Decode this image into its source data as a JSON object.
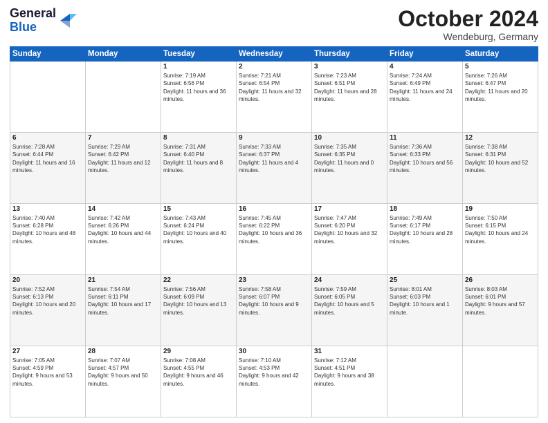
{
  "logo": {
    "line1": "General",
    "line2": "Blue"
  },
  "header": {
    "month": "October 2024",
    "location": "Wendeburg, Germany"
  },
  "weekdays": [
    "Sunday",
    "Monday",
    "Tuesday",
    "Wednesday",
    "Thursday",
    "Friday",
    "Saturday"
  ],
  "weeks": [
    [
      {
        "day": "",
        "sunrise": "",
        "sunset": "",
        "daylight": ""
      },
      {
        "day": "",
        "sunrise": "",
        "sunset": "",
        "daylight": ""
      },
      {
        "day": "1",
        "sunrise": "Sunrise: 7:19 AM",
        "sunset": "Sunset: 6:56 PM",
        "daylight": "Daylight: 11 hours and 36 minutes."
      },
      {
        "day": "2",
        "sunrise": "Sunrise: 7:21 AM",
        "sunset": "Sunset: 6:54 PM",
        "daylight": "Daylight: 11 hours and 32 minutes."
      },
      {
        "day": "3",
        "sunrise": "Sunrise: 7:23 AM",
        "sunset": "Sunset: 6:51 PM",
        "daylight": "Daylight: 11 hours and 28 minutes."
      },
      {
        "day": "4",
        "sunrise": "Sunrise: 7:24 AM",
        "sunset": "Sunset: 6:49 PM",
        "daylight": "Daylight: 11 hours and 24 minutes."
      },
      {
        "day": "5",
        "sunrise": "Sunrise: 7:26 AM",
        "sunset": "Sunset: 6:47 PM",
        "daylight": "Daylight: 11 hours and 20 minutes."
      }
    ],
    [
      {
        "day": "6",
        "sunrise": "Sunrise: 7:28 AM",
        "sunset": "Sunset: 6:44 PM",
        "daylight": "Daylight: 11 hours and 16 minutes."
      },
      {
        "day": "7",
        "sunrise": "Sunrise: 7:29 AM",
        "sunset": "Sunset: 6:42 PM",
        "daylight": "Daylight: 11 hours and 12 minutes."
      },
      {
        "day": "8",
        "sunrise": "Sunrise: 7:31 AM",
        "sunset": "Sunset: 6:40 PM",
        "daylight": "Daylight: 11 hours and 8 minutes."
      },
      {
        "day": "9",
        "sunrise": "Sunrise: 7:33 AM",
        "sunset": "Sunset: 6:37 PM",
        "daylight": "Daylight: 11 hours and 4 minutes."
      },
      {
        "day": "10",
        "sunrise": "Sunrise: 7:35 AM",
        "sunset": "Sunset: 6:35 PM",
        "daylight": "Daylight: 11 hours and 0 minutes."
      },
      {
        "day": "11",
        "sunrise": "Sunrise: 7:36 AM",
        "sunset": "Sunset: 6:33 PM",
        "daylight": "Daylight: 10 hours and 56 minutes."
      },
      {
        "day": "12",
        "sunrise": "Sunrise: 7:38 AM",
        "sunset": "Sunset: 6:31 PM",
        "daylight": "Daylight: 10 hours and 52 minutes."
      }
    ],
    [
      {
        "day": "13",
        "sunrise": "Sunrise: 7:40 AM",
        "sunset": "Sunset: 6:28 PM",
        "daylight": "Daylight: 10 hours and 48 minutes."
      },
      {
        "day": "14",
        "sunrise": "Sunrise: 7:42 AM",
        "sunset": "Sunset: 6:26 PM",
        "daylight": "Daylight: 10 hours and 44 minutes."
      },
      {
        "day": "15",
        "sunrise": "Sunrise: 7:43 AM",
        "sunset": "Sunset: 6:24 PM",
        "daylight": "Daylight: 10 hours and 40 minutes."
      },
      {
        "day": "16",
        "sunrise": "Sunrise: 7:45 AM",
        "sunset": "Sunset: 6:22 PM",
        "daylight": "Daylight: 10 hours and 36 minutes."
      },
      {
        "day": "17",
        "sunrise": "Sunrise: 7:47 AM",
        "sunset": "Sunset: 6:20 PM",
        "daylight": "Daylight: 10 hours and 32 minutes."
      },
      {
        "day": "18",
        "sunrise": "Sunrise: 7:49 AM",
        "sunset": "Sunset: 6:17 PM",
        "daylight": "Daylight: 10 hours and 28 minutes."
      },
      {
        "day": "19",
        "sunrise": "Sunrise: 7:50 AM",
        "sunset": "Sunset: 6:15 PM",
        "daylight": "Daylight: 10 hours and 24 minutes."
      }
    ],
    [
      {
        "day": "20",
        "sunrise": "Sunrise: 7:52 AM",
        "sunset": "Sunset: 6:13 PM",
        "daylight": "Daylight: 10 hours and 20 minutes."
      },
      {
        "day": "21",
        "sunrise": "Sunrise: 7:54 AM",
        "sunset": "Sunset: 6:11 PM",
        "daylight": "Daylight: 10 hours and 17 minutes."
      },
      {
        "day": "22",
        "sunrise": "Sunrise: 7:56 AM",
        "sunset": "Sunset: 6:09 PM",
        "daylight": "Daylight: 10 hours and 13 minutes."
      },
      {
        "day": "23",
        "sunrise": "Sunrise: 7:58 AM",
        "sunset": "Sunset: 6:07 PM",
        "daylight": "Daylight: 10 hours and 9 minutes."
      },
      {
        "day": "24",
        "sunrise": "Sunrise: 7:59 AM",
        "sunset": "Sunset: 6:05 PM",
        "daylight": "Daylight: 10 hours and 5 minutes."
      },
      {
        "day": "25",
        "sunrise": "Sunrise: 8:01 AM",
        "sunset": "Sunset: 6:03 PM",
        "daylight": "Daylight: 10 hours and 1 minute."
      },
      {
        "day": "26",
        "sunrise": "Sunrise: 8:03 AM",
        "sunset": "Sunset: 6:01 PM",
        "daylight": "Daylight: 9 hours and 57 minutes."
      }
    ],
    [
      {
        "day": "27",
        "sunrise": "Sunrise: 7:05 AM",
        "sunset": "Sunset: 4:59 PM",
        "daylight": "Daylight: 9 hours and 53 minutes."
      },
      {
        "day": "28",
        "sunrise": "Sunrise: 7:07 AM",
        "sunset": "Sunset: 4:57 PM",
        "daylight": "Daylight: 9 hours and 50 minutes."
      },
      {
        "day": "29",
        "sunrise": "Sunrise: 7:08 AM",
        "sunset": "Sunset: 4:55 PM",
        "daylight": "Daylight: 9 hours and 46 minutes."
      },
      {
        "day": "30",
        "sunrise": "Sunrise: 7:10 AM",
        "sunset": "Sunset: 4:53 PM",
        "daylight": "Daylight: 9 hours and 42 minutes."
      },
      {
        "day": "31",
        "sunrise": "Sunrise: 7:12 AM",
        "sunset": "Sunset: 4:51 PM",
        "daylight": "Daylight: 9 hours and 38 minutes."
      },
      {
        "day": "",
        "sunrise": "",
        "sunset": "",
        "daylight": ""
      },
      {
        "day": "",
        "sunrise": "",
        "sunset": "",
        "daylight": ""
      }
    ]
  ]
}
